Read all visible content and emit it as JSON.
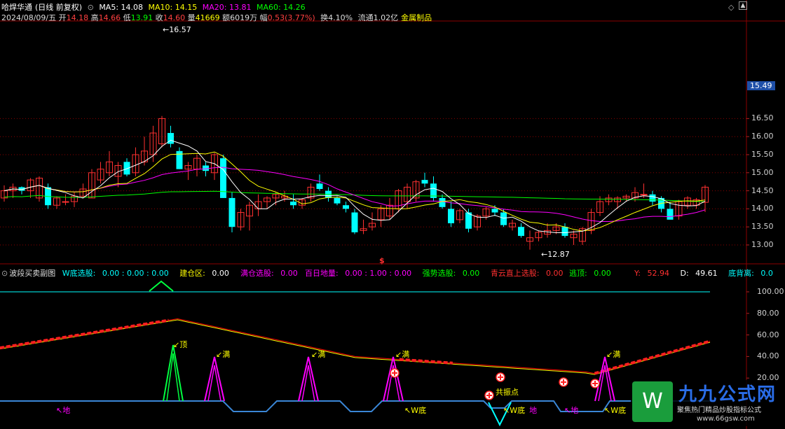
{
  "main_header": {
    "stock_name": "哈焊华通",
    "period": "(日线 前复权)",
    "ma5": "MA5: 14.08",
    "ma10": "MA10: 14.15",
    "ma20": "MA20: 13.81",
    "ma60": "MA60: 14.26",
    "date": "2024/08/09/五",
    "open_lbl": "开",
    "open": "14.18",
    "high_lbl": "高",
    "high": "14.66",
    "low_lbl": "低",
    "low": "13.91",
    "close_lbl": "收",
    "close": "14.60",
    "vol_lbl": "量",
    "vol": "41669",
    "amt_lbl": "额",
    "amt": "6019万",
    "chg_lbl": "幅",
    "chg": "0.53(3.77%)",
    "turnover": "换4.10%",
    "float": "流通1.02亿",
    "sector": "金属制品"
  },
  "price_axis": [
    "16.50",
    "16.00",
    "15.50",
    "15.00",
    "14.50",
    "14.00",
    "13.50",
    "13.00"
  ],
  "current_price_tag": "15.49",
  "high_marker": "16.57",
  "low_marker": "12.87",
  "dollar_marker": "$",
  "sub_header": {
    "title": "波段买卖副图",
    "wdi_lbl": "W底选股:",
    "wdi": "0.00 : 0.00 : 0.00",
    "jcq_lbl": "建仓区:",
    "jcq": "0.00",
    "mc_lbl": "满仓选股:",
    "mc": "0.00",
    "brdl_lbl": "百日地量:",
    "brdl": "0.00 : 1.00 : 0.00",
    "qs_lbl": "强势选股:",
    "qs": "0.00",
    "qy_lbl": "青云直上选股:",
    "qy": "0.00",
    "td_lbl": "逃顶:",
    "td": "0.00",
    "y_lbl": "Y:",
    "y": "52.94",
    "d_lbl": "D:",
    "d": "49.61",
    "dbl_lbl": "底背离:",
    "dbl": "0.0"
  },
  "sub_axis": [
    "100.00",
    "80.00",
    "60.00",
    "40.00",
    "20.00"
  ],
  "sub_labels": {
    "ding": "顶",
    "man": "满",
    "di": "地",
    "wdi": "W底",
    "gongzhen": "共振点",
    "w_di_mix": "W底",
    "di2": "地"
  },
  "watermark": {
    "brand": "九九公式网",
    "slogan": "聚焦热门精品炒股指标公式",
    "url": "www.66gsw.com"
  },
  "colors": {
    "up": "#ff3030",
    "down": "#00ffff",
    "ma5": "#ffffff",
    "ma10": "#ffff00",
    "ma20": "#ff00ff",
    "ma60": "#00ff00",
    "grid": "#8b0000"
  },
  "chart_data": {
    "type": "candlestick",
    "title": "哈焊华通 (日线 前复权)",
    "ylim": [
      12.8,
      16.7
    ],
    "candles": [
      [
        14.3,
        14.65,
        14.2,
        14.5
      ],
      [
        14.5,
        14.7,
        14.3,
        14.6
      ],
      [
        14.6,
        14.62,
        14.4,
        14.5
      ],
      [
        14.5,
        14.85,
        14.3,
        14.8
      ],
      [
        14.3,
        14.9,
        14.2,
        14.85
      ],
      [
        14.6,
        14.7,
        14.0,
        14.1
      ],
      [
        14.1,
        14.35,
        14.0,
        14.3
      ],
      [
        14.2,
        14.4,
        14.1,
        14.2
      ],
      [
        14.2,
        14.45,
        14.05,
        14.35
      ],
      [
        14.35,
        14.7,
        14.3,
        14.55
      ],
      [
        14.3,
        15.1,
        14.3,
        15.0
      ],
      [
        14.8,
        15.3,
        14.7,
        15.1
      ],
      [
        15.0,
        15.6,
        14.9,
        15.3
      ],
      [
        14.9,
        15.3,
        14.6,
        15.2
      ],
      [
        15.3,
        15.4,
        14.9,
        14.95
      ],
      [
        15.0,
        15.7,
        14.9,
        15.5
      ],
      [
        15.3,
        16.0,
        15.2,
        15.6
      ],
      [
        15.5,
        16.3,
        15.3,
        16.1
      ],
      [
        15.8,
        16.57,
        15.7,
        16.5
      ],
      [
        16.1,
        16.3,
        15.7,
        15.8
      ],
      [
        15.6,
        15.7,
        15.1,
        15.1
      ],
      [
        15.1,
        15.3,
        14.8,
        15.2
      ],
      [
        15.1,
        15.5,
        14.9,
        15.4
      ],
      [
        15.2,
        15.3,
        14.9,
        15.05
      ],
      [
        15.0,
        15.55,
        14.8,
        15.5
      ],
      [
        15.4,
        15.5,
        14.3,
        14.3
      ],
      [
        14.3,
        14.45,
        13.35,
        13.5
      ],
      [
        13.5,
        14.0,
        13.4,
        13.9
      ],
      [
        13.8,
        14.2,
        13.4,
        14.1
      ],
      [
        14.0,
        14.4,
        13.8,
        14.2
      ],
      [
        14.2,
        14.35,
        14.0,
        14.3
      ],
      [
        14.3,
        14.45,
        14.1,
        14.4
      ],
      [
        14.3,
        14.5,
        14.2,
        14.35
      ],
      [
        14.2,
        14.4,
        14.0,
        14.1
      ],
      [
        14.1,
        14.3,
        14.0,
        14.25
      ],
      [
        14.3,
        14.7,
        14.2,
        14.6
      ],
      [
        14.7,
        14.95,
        14.5,
        14.55
      ],
      [
        14.5,
        14.6,
        14.2,
        14.3
      ],
      [
        14.3,
        14.35,
        14.1,
        14.15
      ],
      [
        14.1,
        14.2,
        13.9,
        14.0
      ],
      [
        13.9,
        14.0,
        13.3,
        13.35
      ],
      [
        13.4,
        13.7,
        13.3,
        13.45
      ],
      [
        13.5,
        13.9,
        13.4,
        13.6
      ],
      [
        13.7,
        14.1,
        13.5,
        14.0
      ],
      [
        13.8,
        14.3,
        13.7,
        14.1
      ],
      [
        14.0,
        14.55,
        13.9,
        14.5
      ],
      [
        14.2,
        14.7,
        14.0,
        14.6
      ],
      [
        14.3,
        14.8,
        14.2,
        14.75
      ],
      [
        14.8,
        15.0,
        14.6,
        14.7
      ],
      [
        14.7,
        14.9,
        14.2,
        14.3
      ],
      [
        14.3,
        14.4,
        14.0,
        14.05
      ],
      [
        14.0,
        14.2,
        13.5,
        13.6
      ],
      [
        13.7,
        14.0,
        13.6,
        13.95
      ],
      [
        13.9,
        14.0,
        13.35,
        13.45
      ],
      [
        13.5,
        13.85,
        13.4,
        13.8
      ],
      [
        13.8,
        14.05,
        13.7,
        14.0
      ],
      [
        14.0,
        14.1,
        13.8,
        13.9
      ],
      [
        13.9,
        14.0,
        13.5,
        13.55
      ],
      [
        13.5,
        13.7,
        13.4,
        13.6
      ],
      [
        13.5,
        13.6,
        13.2,
        13.25
      ],
      [
        13.1,
        13.4,
        12.87,
        13.2
      ],
      [
        13.2,
        13.4,
        13.1,
        13.35
      ],
      [
        13.3,
        13.6,
        13.2,
        13.4
      ],
      [
        13.4,
        13.6,
        13.3,
        13.5
      ],
      [
        13.5,
        13.6,
        13.2,
        13.25
      ],
      [
        13.2,
        13.4,
        13.0,
        13.3
      ],
      [
        13.1,
        13.5,
        13.0,
        13.45
      ],
      [
        13.4,
        14.0,
        13.3,
        13.9
      ],
      [
        13.9,
        14.35,
        13.8,
        14.2
      ],
      [
        14.2,
        14.4,
        14.1,
        14.3
      ],
      [
        14.2,
        14.35,
        14.0,
        14.3
      ],
      [
        14.3,
        14.4,
        14.2,
        14.35
      ],
      [
        14.3,
        14.6,
        14.2,
        14.45
      ],
      [
        14.4,
        14.7,
        14.3,
        14.4
      ],
      [
        14.4,
        14.5,
        14.1,
        14.2
      ],
      [
        14.3,
        14.35,
        13.9,
        14.0
      ],
      [
        14.0,
        14.2,
        13.8,
        13.7
      ],
      [
        13.8,
        14.25,
        13.7,
        14.2
      ],
      [
        14.1,
        14.35,
        14.0,
        14.3
      ],
      [
        14.1,
        14.3,
        14.0,
        14.25
      ],
      [
        14.18,
        14.66,
        13.91,
        14.6
      ]
    ]
  }
}
